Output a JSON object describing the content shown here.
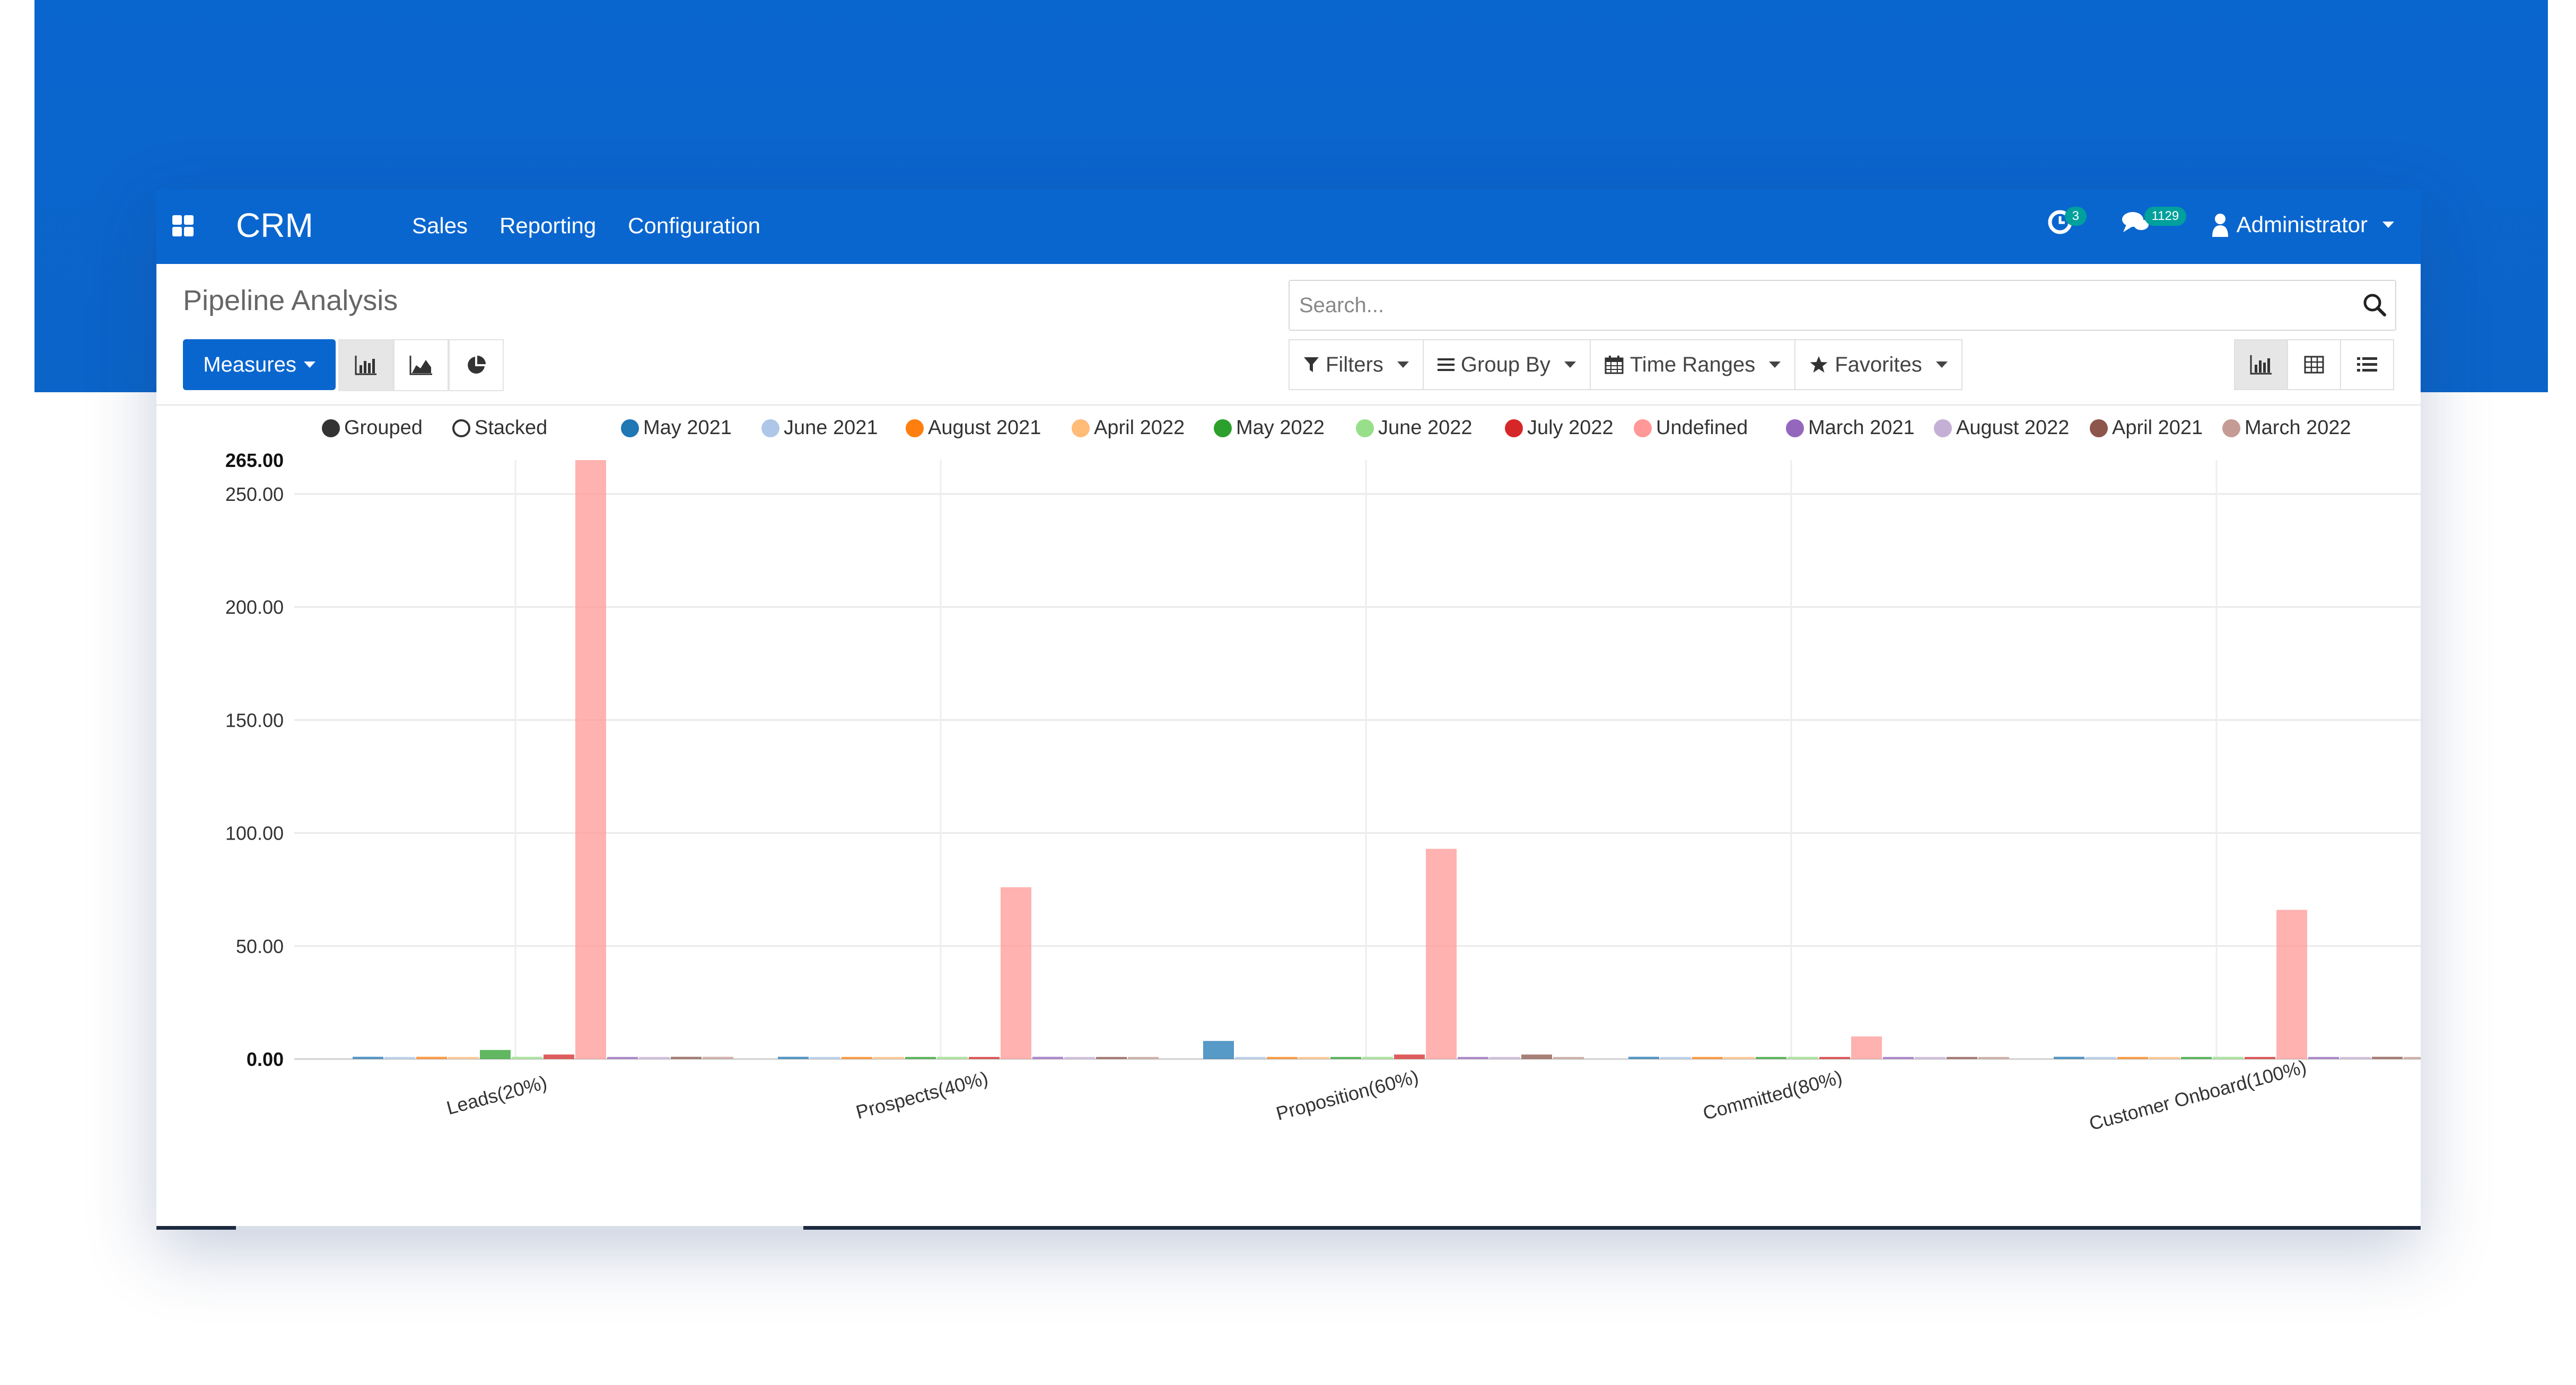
{
  "navbar": {
    "brand": "CRM",
    "menu": [
      "Sales",
      "Reporting",
      "Configuration"
    ],
    "activity_count": "3",
    "message_count": "1129",
    "user": "Administrator"
  },
  "control_panel": {
    "title": "Pipeline Analysis",
    "measures_label": "Measures",
    "search_placeholder": "Search...",
    "filters_label": "Filters",
    "group_by_label": "Group By",
    "time_ranges_label": "Time Ranges",
    "favorites_label": "Favorites"
  },
  "legend": {
    "grouped": "Grouped",
    "stacked": "Stacked"
  },
  "colors": {
    "brand": "#0a66cf",
    "badge": "#00a09d"
  },
  "chart_data": {
    "type": "bar",
    "mode": "grouped",
    "categories": [
      "Leads(20%)",
      "Prospects(40%)",
      "Proposition(60%)",
      "Committed(80%)",
      "Customer Onboard(100%)"
    ],
    "ylim": [
      0,
      265
    ],
    "yticks": [
      "0.00",
      "50.00",
      "100.00",
      "150.00",
      "200.00",
      "250.00",
      "265.00"
    ],
    "grid": true,
    "legend_position": "top",
    "series": [
      {
        "name": "May 2021",
        "color": "#1f77b4",
        "values": [
          1,
          1,
          8,
          1,
          1
        ]
      },
      {
        "name": "June 2021",
        "color": "#aec7e8",
        "values": [
          0,
          0,
          0,
          0,
          0
        ]
      },
      {
        "name": "August 2021",
        "color": "#ff7f0e",
        "values": [
          1,
          0,
          0,
          0,
          0
        ]
      },
      {
        "name": "April 2022",
        "color": "#ffbb78",
        "values": [
          0,
          0,
          0,
          0,
          0
        ]
      },
      {
        "name": "May 2022",
        "color": "#2ca02c",
        "values": [
          4,
          0,
          0,
          0,
          0
        ]
      },
      {
        "name": "June 2022",
        "color": "#98df8a",
        "values": [
          1,
          1,
          1,
          1,
          1
        ]
      },
      {
        "name": "July 2022",
        "color": "#d62728",
        "values": [
          2,
          0,
          2,
          0,
          0
        ]
      },
      {
        "name": "Undefined",
        "color": "#ff9896",
        "values": [
          265,
          76,
          93,
          10,
          66
        ]
      },
      {
        "name": "March 2021",
        "color": "#9467bd",
        "values": [
          0,
          1,
          0,
          0,
          0
        ]
      },
      {
        "name": "August 2022",
        "color": "#c5b0d5",
        "values": [
          0,
          0,
          0,
          0,
          0
        ]
      },
      {
        "name": "April 2021",
        "color": "#8c564b",
        "values": [
          1,
          0,
          2,
          0,
          1
        ]
      },
      {
        "name": "March 2022",
        "color": "#c49c94",
        "values": [
          1,
          0,
          0,
          0,
          0
        ]
      }
    ]
  }
}
